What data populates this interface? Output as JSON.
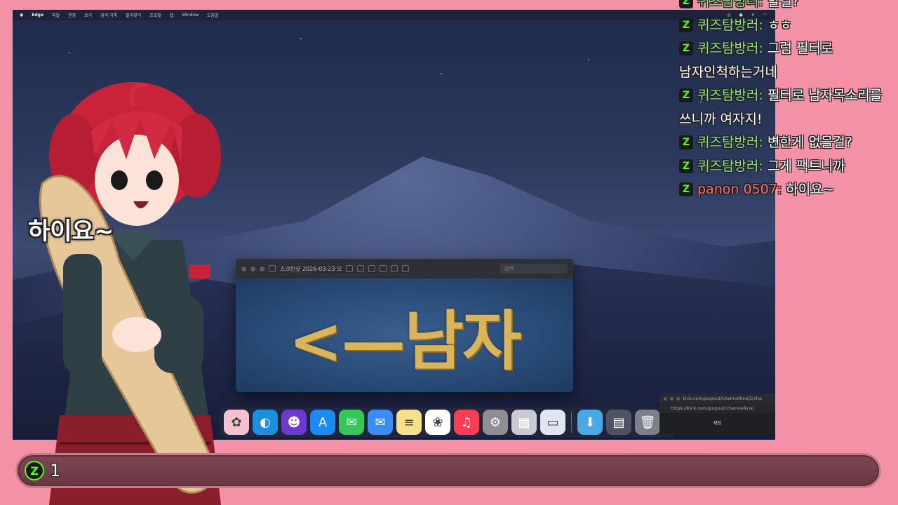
{
  "menubar": {
    "app": "Edge",
    "items": [
      "파일",
      "편집",
      "보기",
      "검색 기록",
      "즐겨찾기",
      "프로필",
      "탭",
      "Window",
      "도움말"
    ]
  },
  "preview": {
    "title": "스크린샷 2026-03-23 오",
    "search_placeholder": "검색",
    "banner": "<—남자"
  },
  "dock": {
    "apps": [
      {
        "name": "photos-bloom",
        "glyph": "✿",
        "color": "#f5c1cf"
      },
      {
        "name": "edge",
        "glyph": "◐",
        "color": "#1d8fe0"
      },
      {
        "name": "discord",
        "glyph": "☻",
        "color": "#6a3ad1"
      },
      {
        "name": "app-store",
        "glyph": "A",
        "color": "#1a8cf0"
      },
      {
        "name": "messages",
        "glyph": "✉",
        "color": "#35c759"
      },
      {
        "name": "mail",
        "glyph": "✉",
        "color": "#3a8df5"
      },
      {
        "name": "notes",
        "glyph": "≡",
        "color": "#f7e08a"
      },
      {
        "name": "photos",
        "glyph": "❀",
        "color": "#ffffff"
      },
      {
        "name": "music",
        "glyph": "♫",
        "color": "#fa3c55"
      },
      {
        "name": "settings",
        "glyph": "⚙",
        "color": "#8e8e93"
      },
      {
        "name": "launchpad",
        "glyph": "▦",
        "color": "#c9cbd3"
      },
      {
        "name": "preview",
        "glyph": "▭",
        "color": "#dfe6f2"
      }
    ],
    "trailing": [
      {
        "name": "downloads",
        "glyph": "⬇",
        "color": "#4aa8e8"
      },
      {
        "name": "recent",
        "glyph": "▤",
        "color": "#505462"
      },
      {
        "name": "trash",
        "glyph": "🗑",
        "color": "#7d808a"
      }
    ]
  },
  "popup": {
    "title": "kick.com/popout/channelknsj1/cha",
    "url": "https://kick.com/popout/channelknsj",
    "tab": "채팅"
  },
  "avatar": {
    "caption": "하이요~"
  },
  "chat": {
    "messages": [
      {
        "user": "퀴즈탐방러",
        "text": "할걸?",
        "user_color": "green"
      },
      {
        "user": "퀴즈탐방러",
        "text": "ㅎㅎ",
        "user_color": "green"
      },
      {
        "user": "퀴즈탐방러",
        "text": "그럼 필터로 남자인척하는거네",
        "user_color": "green"
      },
      {
        "user": "퀴즈탐방러",
        "text": "필터로 남자목소리를 쓰니까 여자지!",
        "user_color": "green"
      },
      {
        "user": "퀴즈탐방러",
        "text": "변한게 없을걸?",
        "user_color": "green"
      },
      {
        "user": "퀴즈탐방러",
        "text": "그게 팩트니까",
        "user_color": "green"
      },
      {
        "user": "panon 0507",
        "text": "하이요~",
        "user_color": "red"
      }
    ]
  },
  "bottombar": {
    "badge": "Z",
    "count": "1"
  },
  "colors": {
    "background": "#f392a6",
    "kick_green": "#53fc18",
    "bar": "#6a3744"
  }
}
